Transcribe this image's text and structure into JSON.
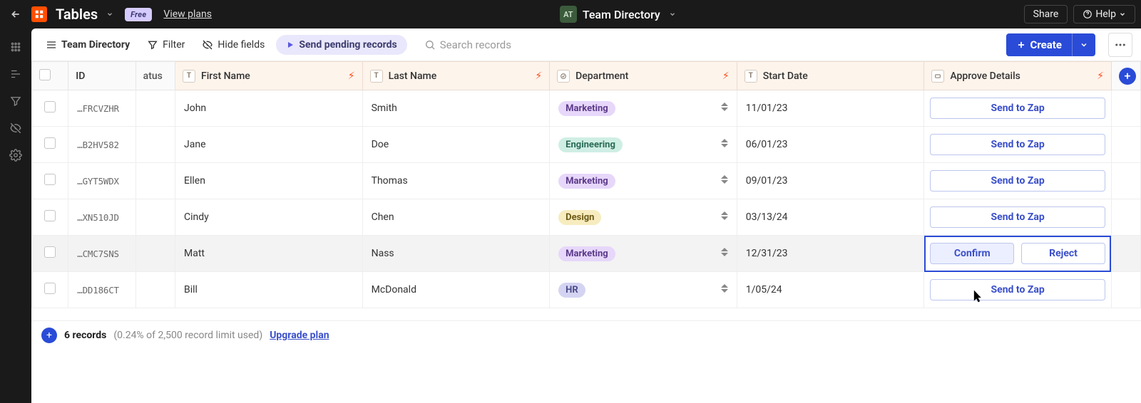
{
  "topbar": {
    "app_name": "Tables",
    "badge": "Free",
    "view_plans": "View plans",
    "workspace_avatar": "AT",
    "workspace_title": "Team Directory",
    "share": "Share",
    "help": "Help"
  },
  "toolbar": {
    "table_name": "Team Directory",
    "filter": "Filter",
    "hide_fields": "Hide fields",
    "send_pending": "Send pending records",
    "search_placeholder": "Search records",
    "create": "Create"
  },
  "columns": {
    "id": "ID",
    "status": "atus",
    "first_name": "First Name",
    "last_name": "Last Name",
    "department": "Department",
    "start_date": "Start Date",
    "approve": "Approve Details"
  },
  "dept_styles": {
    "Marketing": "dept-marketing",
    "Engineering": "dept-engineering",
    "Design": "dept-design",
    "HR": "dept-hr"
  },
  "rows": [
    {
      "id": "…FRCVZHR",
      "first_name": "John",
      "last_name": "Smith",
      "department": "Marketing",
      "start_date": "11/01/23",
      "approve_mode": "send"
    },
    {
      "id": "…B2HV582",
      "first_name": "Jane",
      "last_name": "Doe",
      "department": "Engineering",
      "start_date": "06/01/23",
      "approve_mode": "send"
    },
    {
      "id": "…GYT5WDX",
      "first_name": "Ellen",
      "last_name": "Thomas",
      "department": "Marketing",
      "start_date": "09/01/23",
      "approve_mode": "send"
    },
    {
      "id": "…XN510JD",
      "first_name": "Cindy",
      "last_name": "Chen",
      "department": "Design",
      "start_date": "03/13/24",
      "approve_mode": "send"
    },
    {
      "id": "…CMC7SNS",
      "first_name": "Matt",
      "last_name": "Nass",
      "department": "Marketing",
      "start_date": "12/31/23",
      "approve_mode": "confirm_reject",
      "active": true
    },
    {
      "id": "…DD186CT",
      "first_name": "Bill",
      "last_name": "McDonald",
      "department": "HR",
      "start_date": "1/05/24",
      "approve_mode": "send"
    }
  ],
  "labels": {
    "send_to_zap": "Send to Zap",
    "confirm": "Confirm",
    "reject": "Reject"
  },
  "footer": {
    "count": "6 records",
    "limit": "(0.24% of 2,500 record limit used)",
    "upgrade": "Upgrade plan"
  }
}
